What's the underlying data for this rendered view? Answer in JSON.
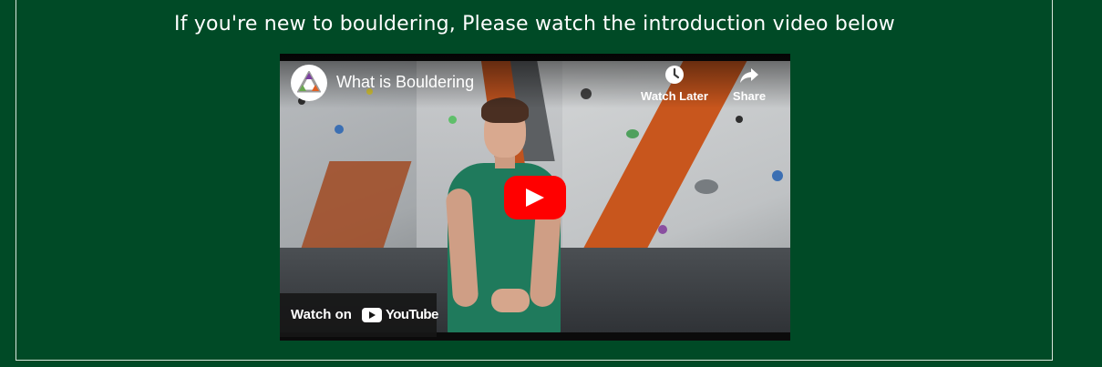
{
  "page": {
    "heading": "If you're new to bouldering, Please watch the introduction video below"
  },
  "video": {
    "title": "What is Bouldering",
    "watch_later_label": "Watch Later",
    "share_label": "Share",
    "watch_on_label": "Watch on",
    "youtube_wordmark": "YouTube",
    "icons": {
      "channel": "channel-avatar-icon",
      "watch_later": "clock-icon",
      "share": "share-arrow-icon",
      "play": "play-icon",
      "youtube": "youtube-logo-icon"
    }
  },
  "colors": {
    "background": "#004a26",
    "text": "#ffffff",
    "play_button": "#ff0000",
    "border": "#d8e6dc"
  }
}
